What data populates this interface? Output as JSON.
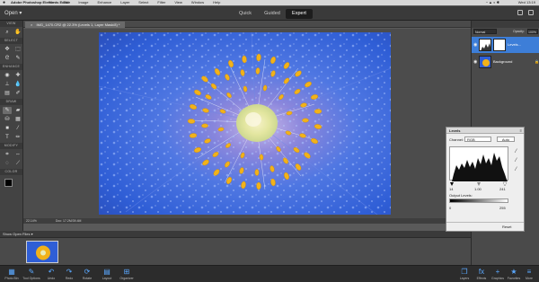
{
  "menubar": {
    "app_name": "Adobe Photoshop Elements Editor",
    "menus": [
      "File",
      "Edit",
      "Image",
      "Enhance",
      "Layer",
      "Select",
      "Filter",
      "View",
      "Window",
      "Help"
    ],
    "clock": "Wed 13:19"
  },
  "topbar": {
    "open_label": "Open",
    "modes": [
      {
        "label": "Quick"
      },
      {
        "label": "Guided"
      },
      {
        "label": "Expert"
      }
    ],
    "active_mode": "Expert"
  },
  "document": {
    "tab_label": "IMG_1470.CR2 @ 22.3% (Levels 1, Layer Mask/8) *",
    "zoom": "22.14%",
    "doc_info": "Doc: 17.2M/39.4M"
  },
  "toolbox": {
    "sections": [
      "VIEW",
      "SELECT",
      "ENHANCE",
      "DRAW",
      "MODIFY",
      "COLOR"
    ]
  },
  "photobin": {
    "dropdown_label": "Show Open Files"
  },
  "bottombar": {
    "left": [
      {
        "label": "Photo Bin",
        "icon": "photo-bin-icon"
      },
      {
        "label": "Tool Options",
        "icon": "tool-options-icon"
      },
      {
        "label": "Undo",
        "icon": "undo-icon"
      },
      {
        "label": "Redo",
        "icon": "redo-icon"
      },
      {
        "label": "Rotate",
        "icon": "rotate-icon"
      },
      {
        "label": "Layout",
        "icon": "layout-icon"
      },
      {
        "label": "Organizer",
        "icon": "organizer-icon"
      }
    ],
    "right": [
      {
        "label": "Layers",
        "icon": "layers-icon"
      },
      {
        "label": "Effects",
        "icon": "effects-icon"
      },
      {
        "label": "Graphics",
        "icon": "graphics-icon"
      },
      {
        "label": "Favorites",
        "icon": "favorites-icon"
      },
      {
        "label": "More",
        "icon": "more-icon"
      }
    ]
  },
  "layers": {
    "blend_mode": "Normal",
    "opacity_label": "Opacity:",
    "opacity": "100%",
    "items": [
      {
        "name": "Levels...",
        "active": true
      },
      {
        "name": "Background",
        "active": false
      }
    ]
  },
  "levels": {
    "title": "Levels",
    "channel_label": "Channel:",
    "channel": "RGB",
    "auto_label": "Auto",
    "input_black": "14",
    "input_gamma": "1.00",
    "input_white": "241",
    "output_label": "Output Levels:",
    "output_black": "0",
    "output_white": "255",
    "reset_label": "Reset"
  },
  "colors": {
    "accent": "#3d7ed8",
    "ui_dark": "#3a3a3a",
    "flower_blue": "#3f6ee0",
    "stamen_yellow": "#f2b21a"
  }
}
